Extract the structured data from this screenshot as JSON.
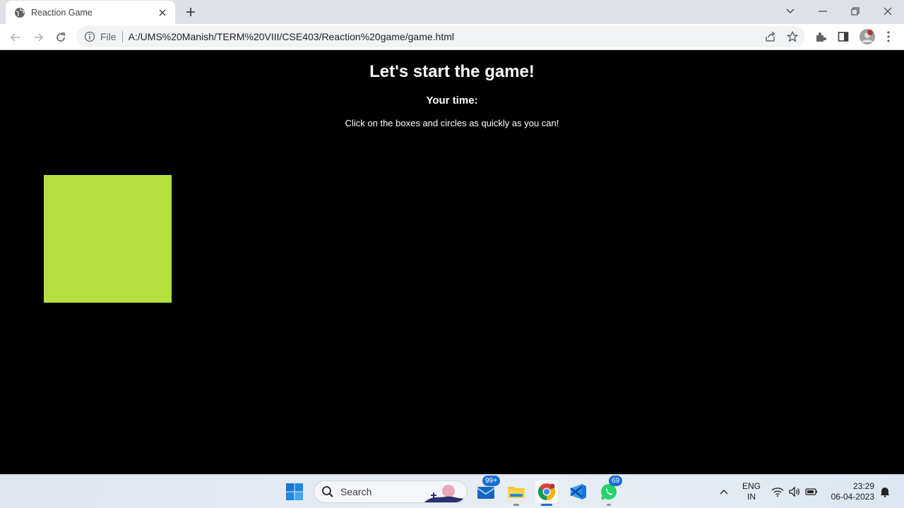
{
  "browser": {
    "tab_title": "Reaction Game",
    "url_scheme": "File",
    "url": "A:/UMS%20Manish/TERM%20VIII/CSE403/Reaction%20game/game.html"
  },
  "page": {
    "heading": "Let's start the game!",
    "time_label": "Your time:",
    "instructions": "Click on the boxes and circles as quickly as you can!",
    "shape_color": "#b3df3f"
  },
  "taskbar": {
    "search_placeholder": "Search",
    "mail_badge": "99+",
    "whatsapp_badge": "69",
    "language_top": "ENG",
    "language_bottom": "IN",
    "time": "23:29",
    "date": "06-04-2023"
  }
}
